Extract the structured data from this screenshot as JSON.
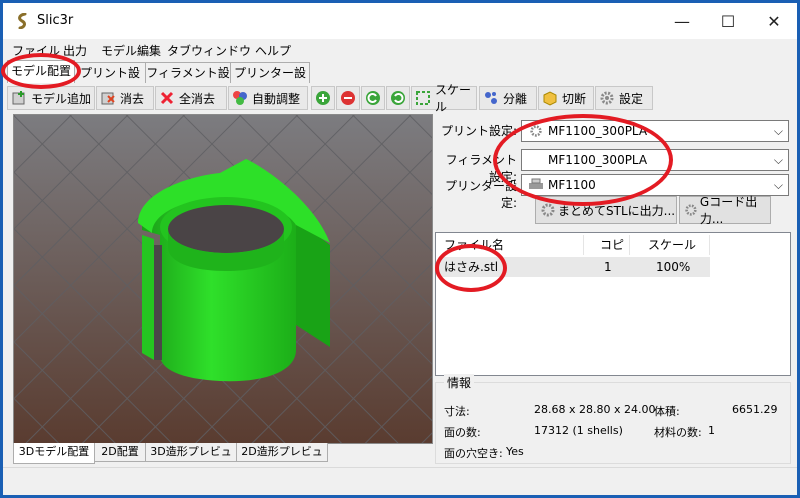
{
  "window": {
    "title": "Slic3r"
  },
  "window_controls": {
    "minimize": "—",
    "maximize": "☐",
    "close": "✕"
  },
  "menu": [
    "ファイル",
    "出力",
    "モデル編集",
    "タブウィンドウ",
    "ヘルプ"
  ],
  "top_tabs": [
    "モデル配置",
    "プリント設定",
    "フィラメント設定",
    "プリンター設定"
  ],
  "toolbar": {
    "add_model": "モデル追加",
    "delete": "消去",
    "delete_all": "全消去",
    "auto_arrange": "自動調整",
    "scale": "スケール",
    "split": "分離",
    "cut": "切断",
    "settings": "設定"
  },
  "bottom_tabs": [
    "3Dモデル配置",
    "2D配置",
    "3D造形プレビュー",
    "2D造形プレビュー"
  ],
  "settings_panel": {
    "print_label": "プリント設定:",
    "print_value": "MF1100_300PLA",
    "filament_label": "フィラメント設定:",
    "filament_value": "MF1100_300PLA",
    "printer_label": "プリンター設定:",
    "printer_value": "MF1100"
  },
  "actions": {
    "export_stl": "まとめてSTLに出力...",
    "export_gcode": "Gコード出力..."
  },
  "object_list": {
    "headers": [
      "ファイル名",
      "コピ",
      "スケール"
    ],
    "rows": [
      {
        "name": "はさみ.stl",
        "copies": "1",
        "scale": "100%"
      }
    ]
  },
  "info": {
    "title": "情報",
    "size_label": "寸法:",
    "size_value": "28.68 x 28.80 x 24.00",
    "volume_label": "体積:",
    "volume_value": "6651.29",
    "facets_label": "面の数:",
    "facets_value": "17312 (1 shells)",
    "materials_label": "材料の数:",
    "materials_value": "1",
    "manifold_label": "面の穴空き:",
    "manifold_value": "Yes"
  },
  "colors": {
    "model_green": "#22d11e",
    "viewport_top": "#7c7c80",
    "viewport_bottom": "#5a3c30",
    "annotation_red": "#e31b23"
  }
}
